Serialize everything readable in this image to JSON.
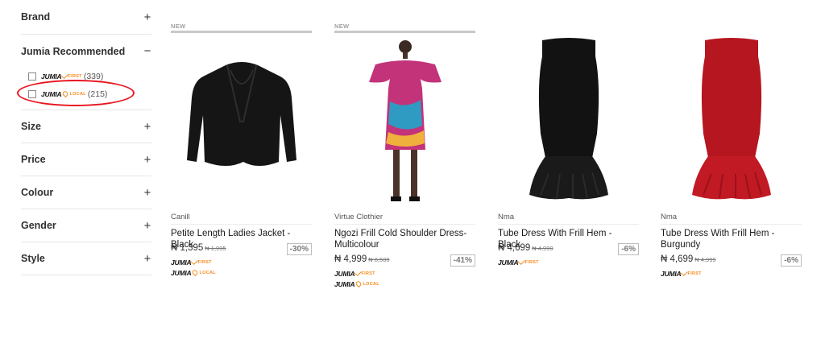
{
  "filters": {
    "brand": {
      "label": "Brand",
      "sign": "+"
    },
    "jumia_recommended": {
      "label": "Jumia Recommended",
      "sign": "−",
      "options": [
        {
          "logo": "JUMIA",
          "tag": "FIRST",
          "count": "(339)"
        },
        {
          "logo": "JUMIA",
          "tag": "LOCAL",
          "count": "(215)"
        }
      ]
    },
    "size": {
      "label": "Size",
      "sign": "+"
    },
    "price": {
      "label": "Price",
      "sign": "+"
    },
    "colour": {
      "label": "Colour",
      "sign": "+"
    },
    "gender": {
      "label": "Gender",
      "sign": "+"
    },
    "style": {
      "label": "Style",
      "sign": "+"
    }
  },
  "badges": {
    "logo": "JUMIA",
    "first": "FIRST",
    "local": "LOCAL"
  },
  "products": [
    {
      "new": "NEW",
      "brand": "Canill",
      "name": "Petite Length Ladies Jacket - Black",
      "price": "₦ 1,395",
      "old_price": "₦ 1,995",
      "discount": "-30%",
      "image_color": "#151515"
    },
    {
      "new": "NEW",
      "brand": "Virtue Clothier",
      "name": "Ngozi Frill Cold Shoulder Dress-Multicolour",
      "price": "₦ 4,999",
      "old_price": "₦ 8,500",
      "discount": "-41%",
      "image_color": "#c2337a"
    },
    {
      "new": "",
      "brand": "Nma",
      "name": "Tube Dress With Frill Hem - Black",
      "price": "₦ 4,699",
      "old_price": "₦ 4,999",
      "discount": "-6%",
      "image_color": "#121212"
    },
    {
      "new": "",
      "brand": "Nma",
      "name": "Tube Dress With Frill Hem - Burgundy",
      "price": "₦ 4,699",
      "old_price": "₦ 4,999",
      "discount": "-6%",
      "image_color": "#b5161f"
    }
  ]
}
